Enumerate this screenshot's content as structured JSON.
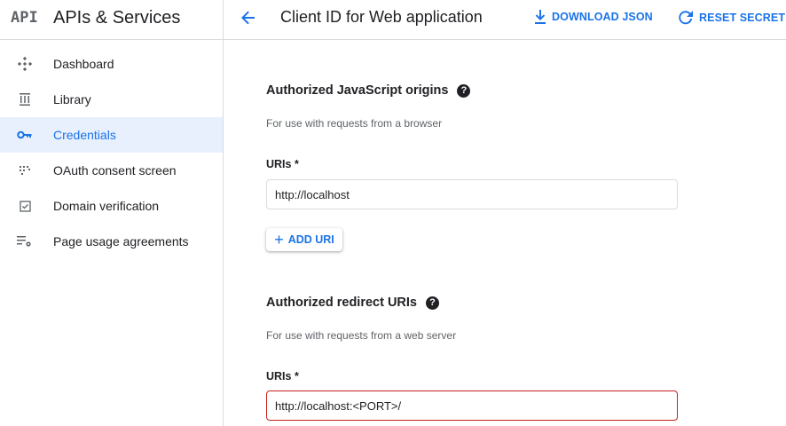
{
  "brand": {
    "logo": "API",
    "title": "APIs & Services"
  },
  "sidebar": {
    "items": [
      {
        "label": "Dashboard",
        "icon": "dashboard-icon"
      },
      {
        "label": "Library",
        "icon": "library-icon"
      },
      {
        "label": "Credentials",
        "icon": "key-icon",
        "active": true
      },
      {
        "label": "OAuth consent screen",
        "icon": "consent-icon"
      },
      {
        "label": "Domain verification",
        "icon": "checkbox-icon"
      },
      {
        "label": "Page usage agreements",
        "icon": "settings-list-icon"
      }
    ]
  },
  "header": {
    "title": "Client ID for Web application",
    "download_label": "DOWNLOAD JSON",
    "reset_label": "RESET SECRET"
  },
  "js_origins": {
    "title": "Authorized JavaScript origins",
    "description": "For use with requests from a browser",
    "uris_label": "URIs *",
    "uri_value": "http://localhost",
    "add_label": "ADD URI"
  },
  "redirect_uris": {
    "title": "Authorized redirect URIs",
    "description": "For use with requests from a web server",
    "uris_label": "URIs *",
    "uri_value": "http://localhost:<PORT>/"
  },
  "colors": {
    "accent": "#1a73e8",
    "active_bg": "#e8f0fe",
    "error": "#c5221f",
    "border": "#dadce0"
  }
}
